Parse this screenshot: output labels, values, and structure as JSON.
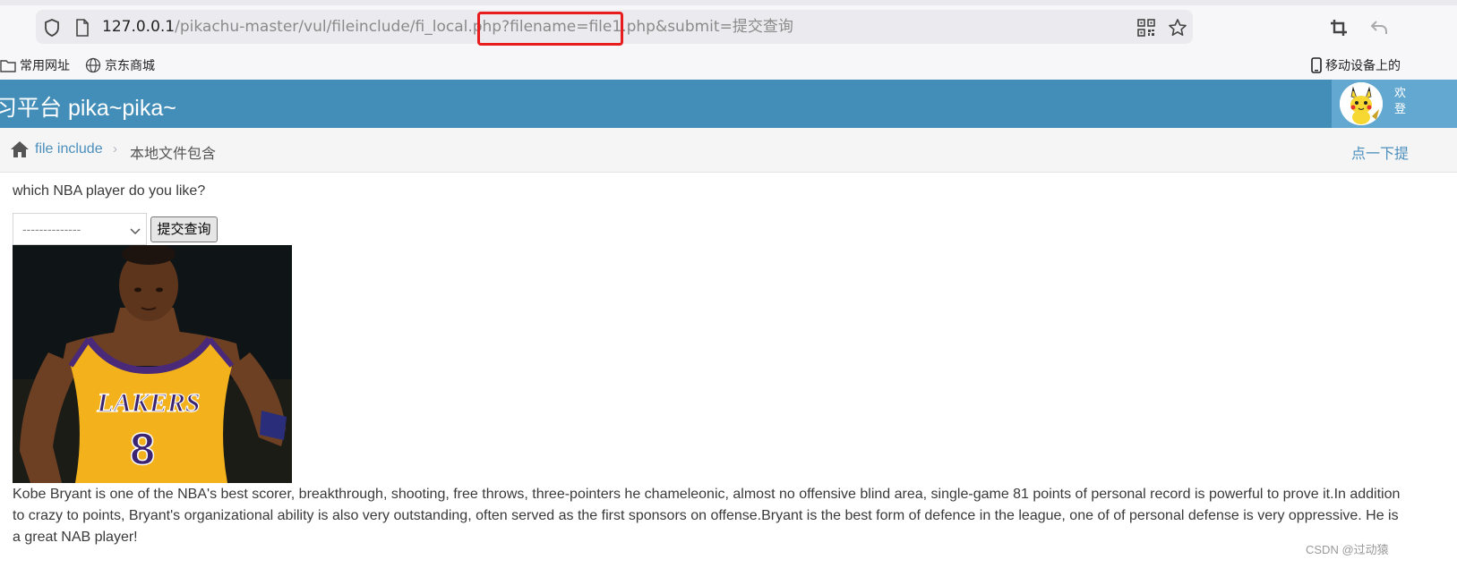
{
  "browser": {
    "url_host": "127.0.0.1",
    "url_path": "/pikachu-master/vul/fileinclude/fi_local.php",
    "url_query": "?filename=file1.php&submit=提交查询",
    "bookmarks": [
      "常用网址",
      "京东商城",
      "移动设备上的"
    ]
  },
  "header": {
    "title": "习平台 pika~pika~",
    "welcome_line1": "欢",
    "welcome_line2": "登"
  },
  "breadcrumb": {
    "link": "file include",
    "current": "本地文件包含",
    "hint": "点一下提"
  },
  "content": {
    "question": "which NBA player do you like?",
    "select_value": "--------------",
    "submit_label": "提交查询",
    "description": "Kobe Bryant is one of the NBA's best scorer, breakthrough, shooting, free throws, three-pointers he chameleonic, almost no offensive blind area, single-game 81 points of personal record is powerful to prove it.In addition to crazy to points, Bryant's organizational ability is also very outstanding, often served as the first sponsors on offense.Bryant is the best form of defence in the league, one of of personal defense is very oppressive. He is a great NAB player!",
    "image_jersey_text": "LAKERS",
    "image_jersey_number": "8"
  },
  "watermark": "CSDN @过动猿",
  "colors": {
    "header_bg": "#438eb9",
    "user_area_bg": "#62a8d1",
    "link": "#4c8fbd",
    "highlight": "#e81c1c"
  },
  "icons": [
    "shield-icon",
    "page-icon",
    "qr-code-icon",
    "star-icon",
    "crop-icon",
    "back-icon",
    "folder-icon",
    "globe-icon",
    "phone-icon",
    "home-icon",
    "chevron-down-icon"
  ]
}
